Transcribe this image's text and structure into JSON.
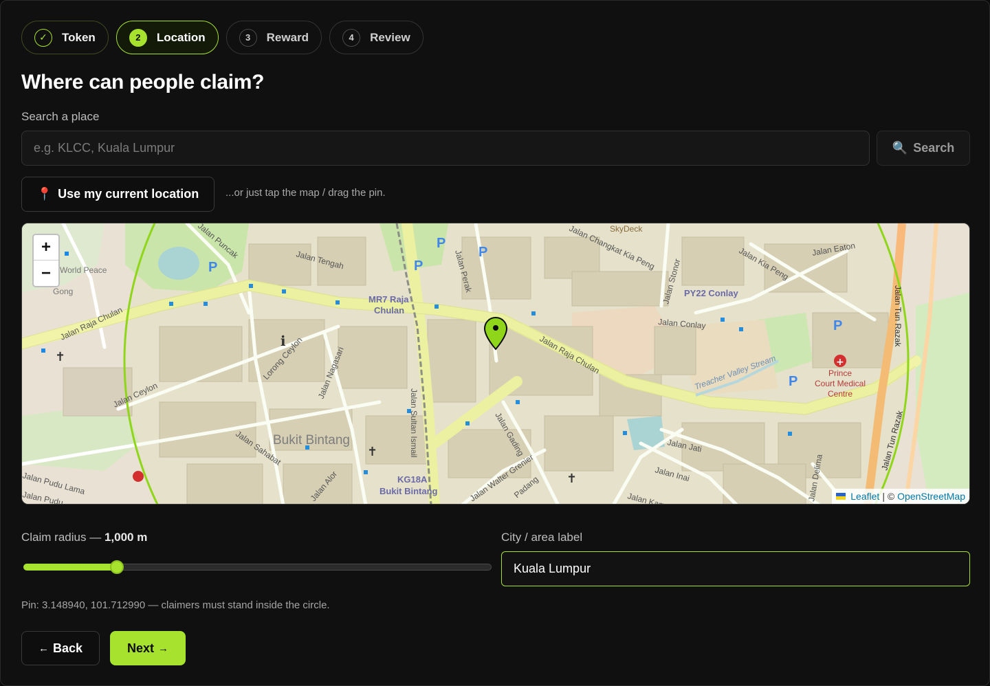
{
  "stepper": {
    "steps": [
      {
        "marker": "✓",
        "label": "Token",
        "state": "done"
      },
      {
        "marker": "2",
        "label": "Location",
        "state": "active"
      },
      {
        "marker": "3",
        "label": "Reward",
        "state": "upcoming"
      },
      {
        "marker": "4",
        "label": "Review",
        "state": "upcoming"
      }
    ]
  },
  "heading": "Where can people claim?",
  "search": {
    "label": "Search a place",
    "placeholder": "e.g. KLCC, Kuala Lumpur",
    "value": "",
    "button_icon": "🔍",
    "button_label": "Search"
  },
  "location": {
    "button_icon": "📍",
    "button_label": "Use my current location",
    "hint": "...or just tap the map / drag the pin."
  },
  "map": {
    "zoom_in": "+",
    "zoom_out": "−",
    "attribution_leaflet": "Leaflet",
    "attribution_sep": "| ©",
    "attribution_osm": "OpenStreetMap",
    "labels": {
      "skydeck": "SkyDeck",
      "jalan_tengah": "Jalan Tengah",
      "mr7": "MR7 Raja",
      "chulan": "Chulan",
      "py22": "PY22 Conlay",
      "jalan_conlay": "Jalan Conlay",
      "jalan_raja_chulan_w": "Jalan Raja Chulan",
      "jalan_raja_chulan_e": "Jalan Raja Chulan",
      "jalan_kia_peng": "Jalan Kia Peng",
      "lorong_ceylon": "Lorong Ceylon",
      "jalan_nagasari": "Jalan Nagasari",
      "jalan_ceylon": "Jalan Ceylon",
      "jalan_sahabat": "Jalan Sahabat",
      "bukit_bintang": "Bukit Bintang",
      "kg18a": "KG18A",
      "kg18a_sub": "Bukit Bintang",
      "jalan_gading": "Jalan Gading",
      "jalan_jati": "Jalan Jati",
      "jalan_inai": "Jalan Inai",
      "prince_1": "Prince",
      "prince_2": "Court Medical",
      "prince_3": "Centre",
      "jalan_tun_razak": "Jalan Tun Razak",
      "treacher": "Treacher Valley Stream",
      "jalan_eaton": "Jalan Eaton",
      "jalan_sultan_ismail": "Jalan Sultan Ismail",
      "world_peace": "World Peace",
      "gong": "Gong",
      "jalan_pudu_lama": "Jalan Pudu Lama",
      "jalan_pudu": "Jalan Pudu",
      "jalan_alor": "Jalan Alor",
      "jalan_walter_grenier": "Jalan Walter Grenier",
      "jalan_padang": "Padang",
      "jalan_stonor": "Jalan Stonor",
      "jalan_perak": "Jalan Perak",
      "jalan_puncak": "Jalan Puncak",
      "jalan_delima": "Jalan Delima",
      "jalan_tun_razak_2": "Jalan Tun Razak",
      "jalan_kamuning": "Jalan Kam",
      "jalan_changkat": "Jalan Changkat Kia Peng"
    }
  },
  "radius": {
    "label_prefix": "Claim radius —",
    "value_text": "1,000 m",
    "fraction": 0.2
  },
  "city": {
    "label": "City / area label",
    "value": "Kuala Lumpur"
  },
  "pin_text": "Pin: 3.148940, 101.712990 — claimers must stand inside the circle.",
  "nav": {
    "back_arrow": "←",
    "back_label": "Back",
    "next_label": "Next",
    "next_arrow": "→"
  },
  "colors": {
    "accent": "#a6e22e",
    "background": "#101010"
  }
}
